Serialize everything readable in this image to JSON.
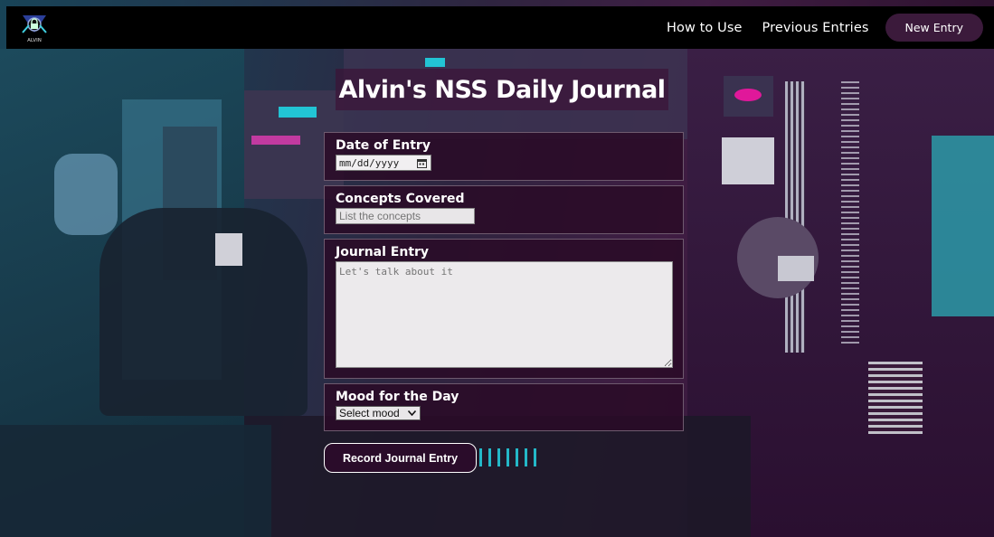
{
  "header": {
    "logo_text": "ALVIN",
    "nav": [
      {
        "label": "How to Use"
      },
      {
        "label": "Previous Entries"
      }
    ],
    "new_entry_label": "New Entry"
  },
  "page": {
    "title": "Alvin's NSS Daily Journal"
  },
  "form": {
    "date": {
      "label": "Date of Entry",
      "placeholder": "mm/dd/yyyy"
    },
    "concepts": {
      "label": "Concepts Covered",
      "placeholder": "List the concepts"
    },
    "entry": {
      "label": "Journal Entry",
      "placeholder": "Let's talk about it"
    },
    "mood": {
      "label": "Mood for the Day",
      "selected": "Select mood"
    },
    "submit_label": "Record Journal Entry"
  },
  "colors": {
    "topbar": "#000000",
    "accent_button": "#3b1a3b",
    "card_bg": "#2a0a26"
  }
}
